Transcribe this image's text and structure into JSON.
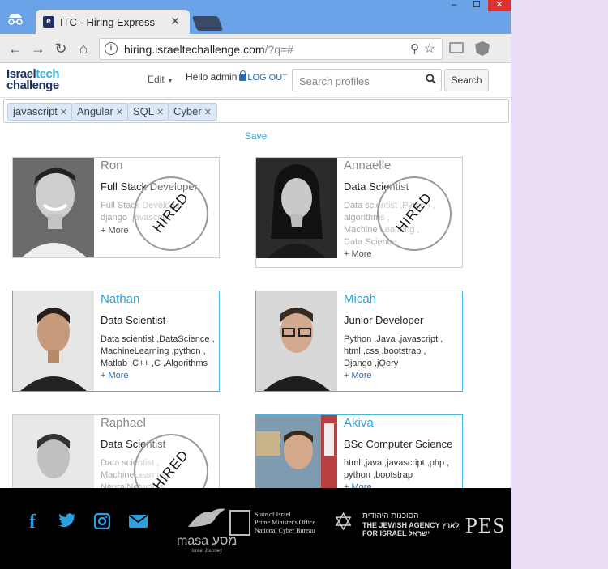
{
  "browser": {
    "tab_title": "ITC - Hiring Express",
    "tab_favicon": "e",
    "url_main": "hiring.israeltechallenge.com",
    "url_tail": "/?q=#"
  },
  "header": {
    "logo_line1_a": "Israel",
    "logo_line1_b": "tech",
    "logo_line2": "challenge",
    "edit_label": "Edit",
    "greeting": "Hello admin",
    "logout_label": "LOG OUT",
    "search_placeholder": "Search profiles",
    "search_button": "Search"
  },
  "tags": [
    {
      "label": "javascript"
    },
    {
      "label": "Angular"
    },
    {
      "label": "SQL"
    },
    {
      "label": "Cyber"
    }
  ],
  "save_label": "Save",
  "hired_stamp": "HIRED",
  "more_label": "+ More",
  "profiles": [
    {
      "name": "Ron",
      "role": "Full Stack Developer",
      "skills": [
        "Full Stack Developer ,",
        "django ,javascript"
      ],
      "hired": true
    },
    {
      "name": "Annaelle",
      "role": "Data Scientist",
      "skills": [
        "Data scientist ,Python ,",
        "algorithms ,",
        "Machine Learning ,",
        "Data Science"
      ],
      "hired": true
    },
    {
      "name": "Nathan",
      "role": "Data Scientist",
      "skills": [
        "Data scientist ,DataScience ,",
        "MachineLearning ,python ,",
        "Matlab ,C++ ,C ,Algorithms"
      ],
      "hired": false
    },
    {
      "name": "Micah",
      "role": "Junior Developer",
      "skills": [
        "Python ,Java ,javascript ,",
        "html ,css ,bootstrap ,",
        "Django ,jQery"
      ],
      "hired": false
    },
    {
      "name": "Raphael",
      "role": "Data Scientist",
      "skills": [
        "Data scientist ,",
        "MachineLearning ,",
        "NeuralNetworks"
      ],
      "hired": true
    },
    {
      "name": "Akiva",
      "role": "BSc Computer Science",
      "skills": [
        "html ,java ,javascript ,php ,",
        "python ,bootstrap"
      ],
      "hired": false
    }
  ],
  "footer": {
    "masa_word": "masa מסע",
    "masa_sub": "Israel Journey",
    "pmo_line1": "State of Israel",
    "pmo_line2": "Prime Minister's Office",
    "pmo_line3": "National Cyber Bureau",
    "ja_hebrew": "הסוכנות היהודית",
    "ja_english1": "THE JEWISH AGENCY לארץ",
    "ja_english2": "FOR ISRAEL ישראל",
    "pes": "PES"
  },
  "colors": {
    "accent": "#2aa5dc",
    "brand_navy": "#1e2f63",
    "footer_social": "#2b9fe0"
  }
}
